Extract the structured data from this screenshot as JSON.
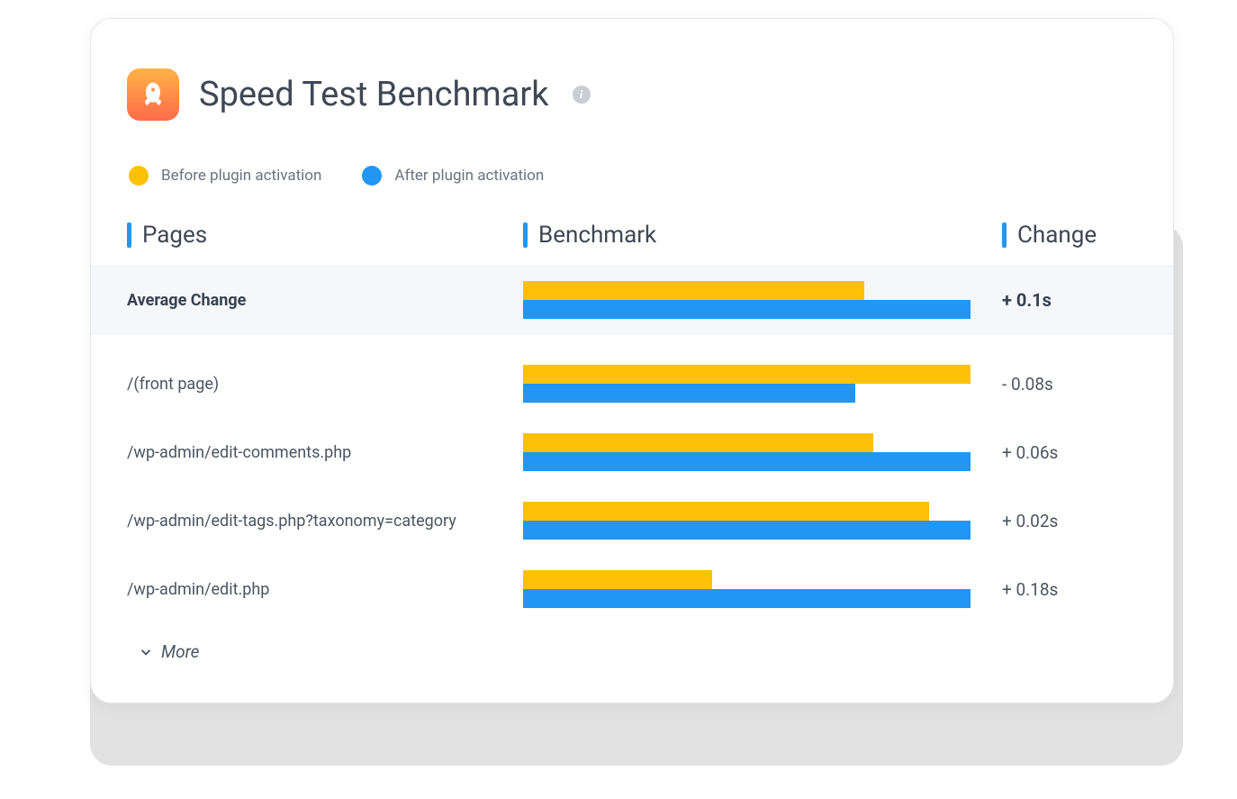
{
  "header": {
    "title": "Speed Test Benchmark",
    "info_badge": "i"
  },
  "legend": {
    "before_label": "Before plugin activation",
    "after_label": "After plugin activation"
  },
  "columns": {
    "pages": "Pages",
    "benchmark": "Benchmark",
    "change": "Change"
  },
  "colors": {
    "before": "#ffc107",
    "after": "#2196f3",
    "accent": "#2196f3"
  },
  "rows": [
    {
      "label": "Average Change",
      "before_pct": 74,
      "after_pct": 97,
      "change": "+ 0.1s",
      "highlight": true
    },
    {
      "label": "/(front page)",
      "before_pct": 97,
      "after_pct": 72,
      "change": "- 0.08s",
      "highlight": false
    },
    {
      "label": "/wp-admin/edit-comments.php",
      "before_pct": 76,
      "after_pct": 97,
      "change": "+ 0.06s",
      "highlight": false
    },
    {
      "label": "/wp-admin/edit-tags.php?taxonomy=category",
      "before_pct": 88,
      "after_pct": 97,
      "change": "+ 0.02s",
      "highlight": false
    },
    {
      "label": "/wp-admin/edit.php",
      "before_pct": 41,
      "after_pct": 97,
      "change": "+ 0.18s",
      "highlight": false
    }
  ],
  "more_label": "More",
  "chart_data": {
    "type": "bar",
    "title": "Speed Test Benchmark",
    "categories": [
      "Average Change",
      "/(front page)",
      "/wp-admin/edit-comments.php",
      "/wp-admin/edit-tags.php?taxonomy=category",
      "/wp-admin/edit.php"
    ],
    "series": [
      {
        "name": "Before plugin activation",
        "values": [
          74,
          97,
          76,
          88,
          41
        ]
      },
      {
        "name": "After plugin activation",
        "values": [
          97,
          72,
          97,
          97,
          97
        ]
      }
    ],
    "change": [
      "+ 0.1s",
      "- 0.08s",
      "+ 0.06s",
      "+ 0.02s",
      "+ 0.18s"
    ],
    "xlabel": "",
    "ylabel": "",
    "ylim": [
      0,
      100
    ]
  }
}
